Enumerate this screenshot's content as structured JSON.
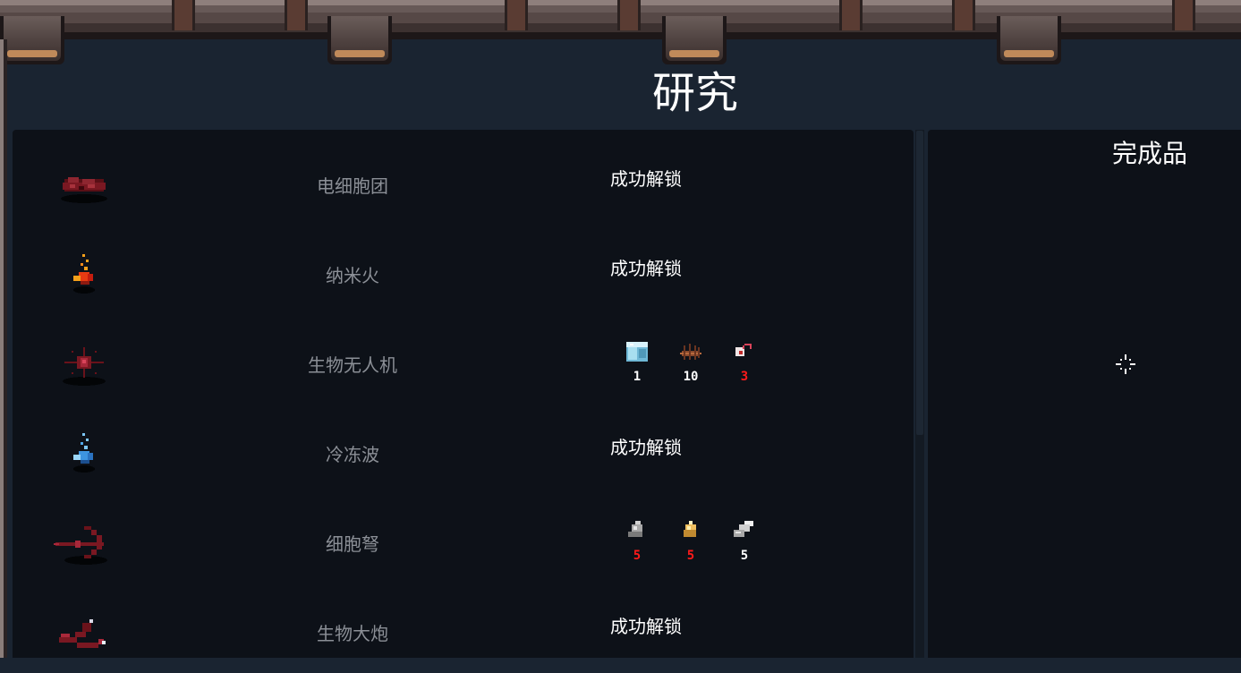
{
  "header": {
    "title": "研究"
  },
  "side_panel": {
    "title": "完成品"
  },
  "colors": {
    "insufficient": "#ff1a1a",
    "sufficient": "#ffffff"
  },
  "research_items": [
    {
      "icon": "cell-cluster-icon",
      "name": "电细胞团",
      "status": "成功解锁",
      "materials": []
    },
    {
      "icon": "nano-fire-icon",
      "name": "纳米火",
      "status": "成功解锁",
      "materials": []
    },
    {
      "icon": "bio-drone-icon",
      "name": "生物无人机",
      "status": "",
      "materials": [
        {
          "icon": "ice-cube-icon",
          "count": "1",
          "sufficient": true
        },
        {
          "icon": "fiber-bundle-icon",
          "count": "10",
          "sufficient": true
        },
        {
          "icon": "eyeball-icon",
          "count": "3",
          "sufficient": false
        }
      ]
    },
    {
      "icon": "freeze-wave-icon",
      "name": "冷冻波",
      "status": "成功解锁",
      "materials": []
    },
    {
      "icon": "cell-crossbow-icon",
      "name": "细胞弩",
      "status": "",
      "materials": [
        {
          "icon": "stone-shard-icon",
          "count": "5",
          "sufficient": false
        },
        {
          "icon": "amber-crystal-icon",
          "count": "5",
          "sufficient": false
        },
        {
          "icon": "metal-ingot-icon",
          "count": "5",
          "sufficient": true
        }
      ]
    },
    {
      "icon": "bio-cannon-icon",
      "name": "生物大炮",
      "status": "成功解锁",
      "materials": []
    }
  ]
}
